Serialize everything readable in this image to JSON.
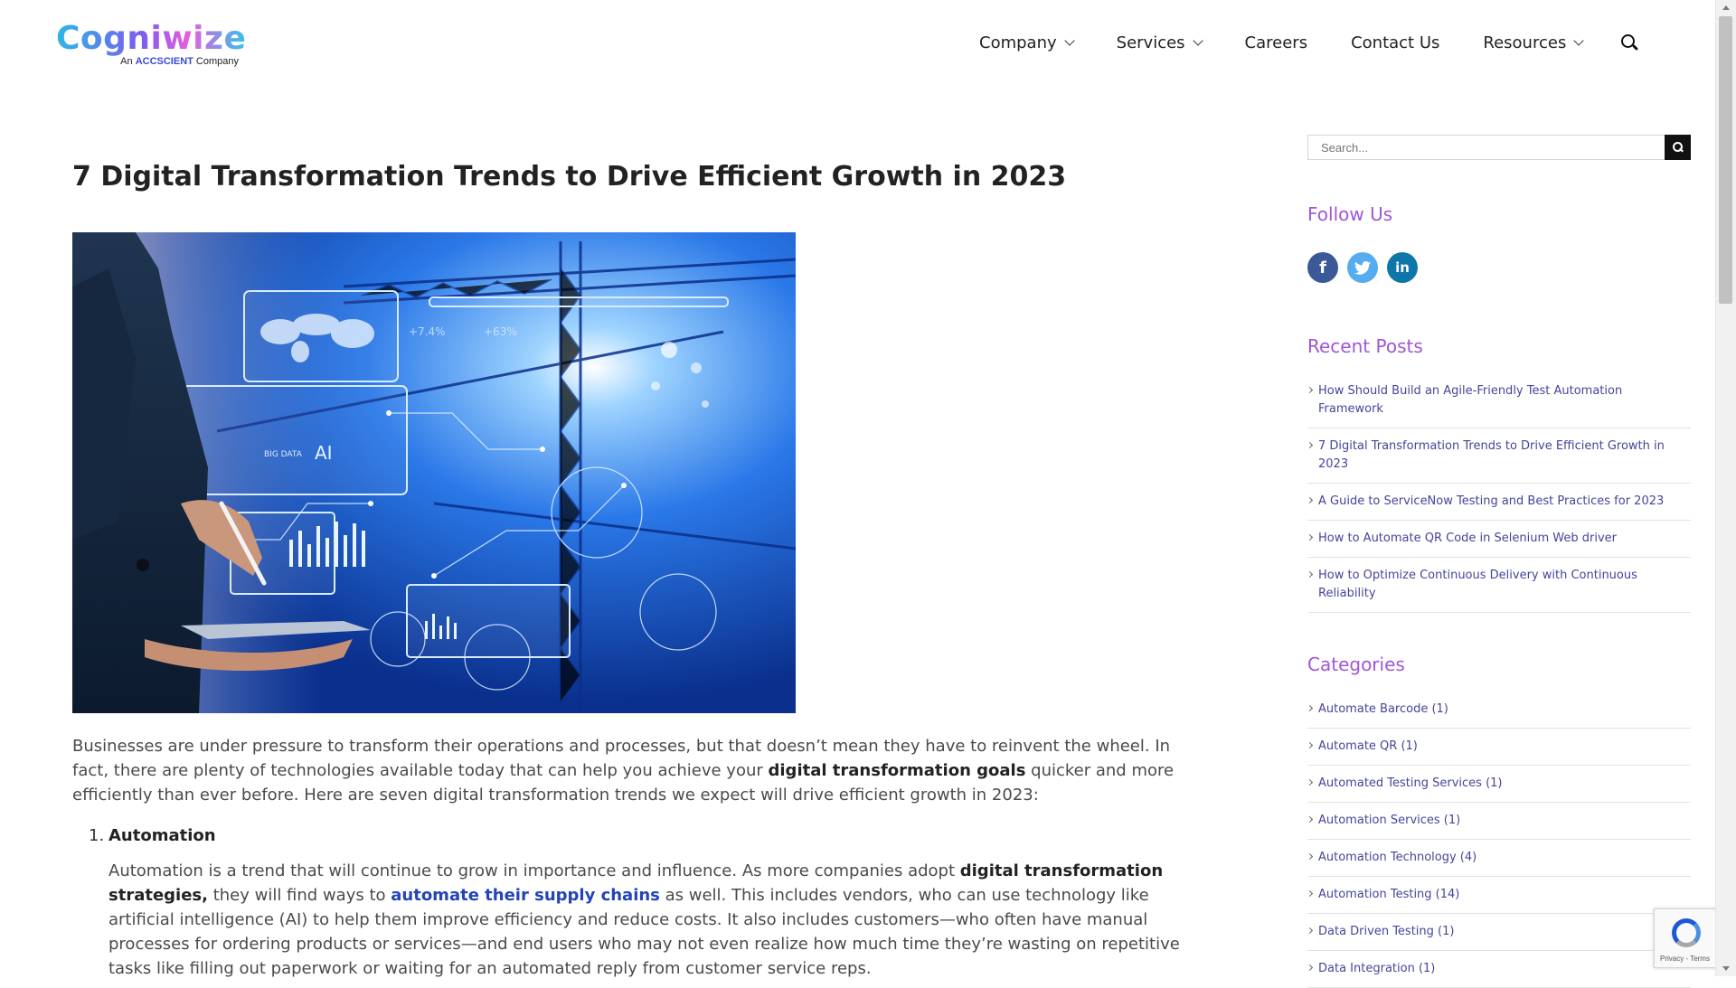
{
  "brand": {
    "name": "Cogniwize",
    "tagline_prefix": "An",
    "tagline_brand": "ACCSCIENT",
    "tagline_suffix": "Company"
  },
  "nav": {
    "items": [
      {
        "label": "Company",
        "has_dropdown": true
      },
      {
        "label": "Services",
        "has_dropdown": true
      },
      {
        "label": "Careers",
        "has_dropdown": false
      },
      {
        "label": "Contact Us",
        "has_dropdown": false
      },
      {
        "label": "Resources",
        "has_dropdown": true
      }
    ],
    "search_icon": "search-icon"
  },
  "article": {
    "title": "7 Digital Transformation Trends to Drive Efficient Growth in 2023",
    "hero_text": {
      "ai": "AI",
      "bigdata": "BIG DATA",
      "pct1": "+7.4%",
      "pct2": "+63%"
    },
    "intro": {
      "part1": "Businesses are under pressure to transform their operations and processes, but that doesn’t mean they have to reinvent the wheel. In fact, there are plenty of technologies available today that can help you achieve your ",
      "bold1": "digital transformation goals",
      "part2": " quicker and more efficiently than ever before. Here are seven digital transformation trends we expect will drive efficient growth in 2023:"
    },
    "list_item_1": {
      "number": "1.",
      "heading": "Automation",
      "body_part1": "Automation is a trend that will continue to grow in importance and influence. As more companies adopt ",
      "body_bold": "digital transformation strategies,",
      "body_part2": " they will find ways to ",
      "body_link": "automate their supply chains",
      "body_part3": " as well. This includes vendors, who can use technology like artificial intelligence (AI) to help them improve efficiency and reduce costs. It also includes customers—who often have manual processes for ordering products or services—and end users who may not even realize how much time they’re wasting on repetitive tasks like filling out paperwork or waiting for an automated reply from customer service reps."
    }
  },
  "sidebar": {
    "search_placeholder": "Search...",
    "follow_title": "Follow Us",
    "social": [
      {
        "icon": "facebook-icon",
        "glyph": "f"
      },
      {
        "icon": "twitter-icon",
        "glyph": ""
      },
      {
        "icon": "linkedin-icon",
        "glyph": "in"
      }
    ],
    "recent_title": "Recent Posts",
    "recent_posts": [
      "How Should Build an Agile-Friendly Test Automation Framework",
      "7 Digital Transformation Trends to Drive Efficient Growth in 2023",
      "A Guide to ServiceNow Testing and Best Practices for 2023",
      "How to Automate QR Code in Selenium Web driver",
      "How to Optimize Continuous Delivery with Continuous Reliability"
    ],
    "categories_title": "Categories",
    "categories": [
      "Automate Barcode (1)",
      "Automate QR (1)",
      "Automated Testing Services (1)",
      "Automation Services (1)",
      "Automation Technology (4)",
      "Automation Testing (14)",
      "Data Driven Testing (1)",
      "Data Integration (1)"
    ]
  },
  "recaptcha": {
    "text": "Privacy - Terms"
  },
  "colors": {
    "accent_purple": "#a155d8",
    "link_blue": "#2344b8",
    "sidebar_link": "#46449a"
  }
}
